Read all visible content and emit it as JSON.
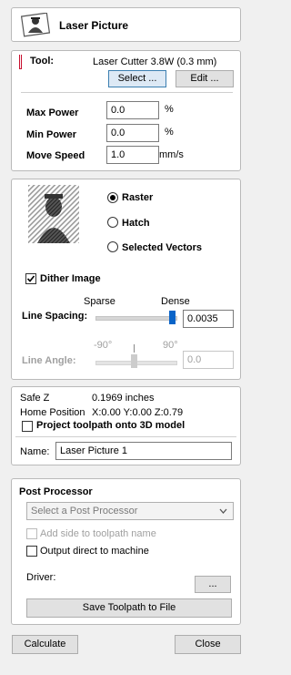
{
  "header": {
    "title": "Laser Picture"
  },
  "tool": {
    "label": "Tool:",
    "name": "Laser Cutter 3.8W (0.3 mm)",
    "select_label": "Select ...",
    "edit_label": "Edit ..."
  },
  "power": {
    "max_label": "Max Power",
    "max_value": "0.0",
    "max_unit": "%",
    "min_label": "Min Power",
    "min_value": "0.0",
    "min_unit": "%",
    "speed_label": "Move Speed",
    "speed_value": "1.0",
    "speed_unit": "mm/s"
  },
  "mode": {
    "options": [
      "Raster",
      "Hatch",
      "Selected Vectors"
    ],
    "selected": "Raster",
    "dither_label": "Dither Image",
    "dither_checked": true
  },
  "spacing": {
    "sparse_label": "Sparse",
    "dense_label": "Dense",
    "label": "Line Spacing:",
    "value": "0.0035",
    "slider_fraction": 1.0
  },
  "angle": {
    "min_label": "-90°",
    "max_label": "90°",
    "label": "Line Angle:",
    "value": "0.0",
    "slider_fraction": 0.5
  },
  "info": {
    "safe_z_label": "Safe Z",
    "safe_z_value": "0.1969 inches",
    "home_label": "Home Position",
    "home_value": "X:0.00 Y:0.00 Z:0.79",
    "project_label": "Project toolpath onto 3D model",
    "name_label": "Name:",
    "name_value": "Laser Picture 1"
  },
  "post": {
    "title": "Post Processor",
    "dropdown_value": "Select a Post Processor",
    "add_side_label": "Add side to toolpath name",
    "output_direct_label": "Output direct to machine",
    "driver_label": "Driver:",
    "driver_button": "...",
    "save_button": "Save Toolpath to File"
  },
  "footer": {
    "calculate_label": "Calculate",
    "close_label": "Close"
  },
  "colors": {
    "tool_marker": "#c8102e",
    "slider_thumb": "#0a64c8"
  }
}
